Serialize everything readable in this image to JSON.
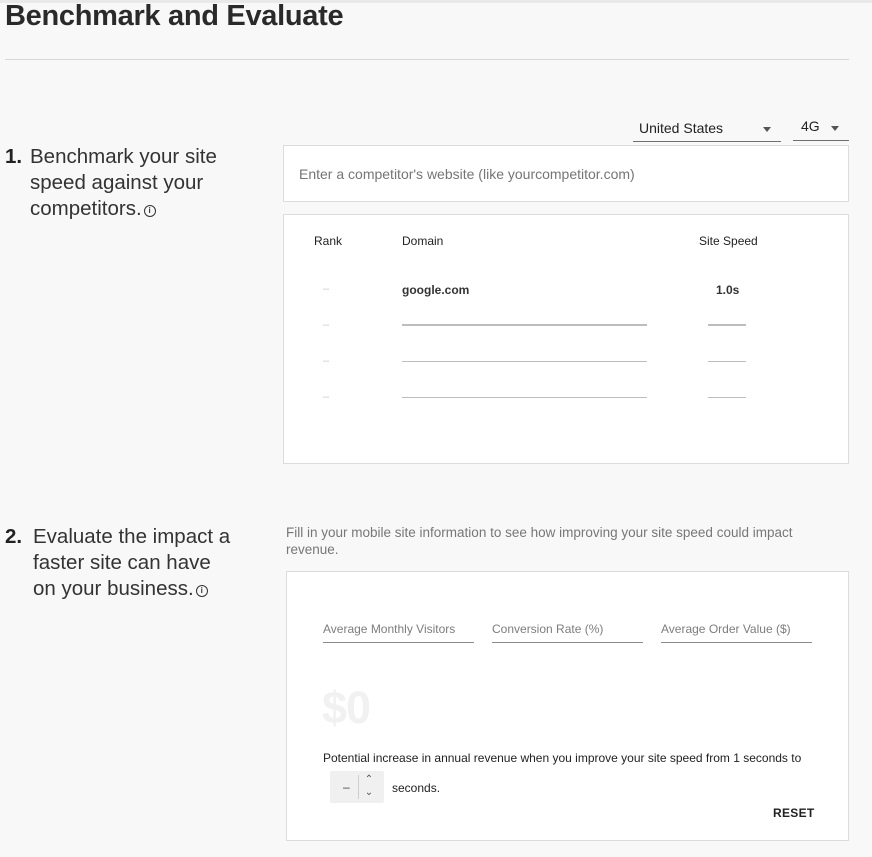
{
  "page": {
    "title": "Benchmark and Evaluate"
  },
  "filters": {
    "country": "United States",
    "network": "4G"
  },
  "step1": {
    "number": "1.",
    "text": "Benchmark your site speed against your competitors."
  },
  "competitor_input": {
    "placeholder": "Enter a competitor's website (like yourcompetitor.com)"
  },
  "table": {
    "headers": {
      "rank": "Rank",
      "domain": "Domain",
      "speed": "Site Speed"
    },
    "rows": [
      {
        "rank": "–",
        "domain": "google.com",
        "speed": "1.0s"
      },
      {
        "rank": "–",
        "domain": "",
        "speed": ""
      },
      {
        "rank": "–",
        "domain": "",
        "speed": ""
      },
      {
        "rank": "–",
        "domain": "",
        "speed": ""
      }
    ]
  },
  "step2": {
    "number": "2.",
    "text": "Evaluate the impact a faster site can have on your business."
  },
  "revenue": {
    "description": "Fill in your mobile site information to see how improving your site speed could impact revenue.",
    "visitors_placeholder": "Average Monthly Visitors",
    "conversion_placeholder": "Conversion Rate (%)",
    "order_placeholder": "Average Order Value ($)",
    "amount": "$0",
    "potential_text": "Potential increase in annual revenue when you improve your site speed from 1 seconds to",
    "stepper_value": "–",
    "seconds_label": "seconds.",
    "reset_label": "RESET"
  }
}
